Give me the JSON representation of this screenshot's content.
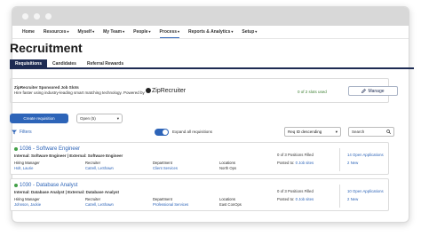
{
  "nav": {
    "items": [
      {
        "label": "Home",
        "caret": false
      },
      {
        "label": "Resources",
        "caret": true
      },
      {
        "label": "Myself",
        "caret": true
      },
      {
        "label": "My Team",
        "caret": true
      },
      {
        "label": "People",
        "caret": true
      },
      {
        "label": "Process",
        "caret": true
      },
      {
        "label": "Reports & Analytics",
        "caret": true
      },
      {
        "label": "Setup",
        "caret": true
      }
    ],
    "active": "Process"
  },
  "page_title": "Recruitment",
  "tabs": [
    "Requisitions",
    "Candidates",
    "Referral Rewards"
  ],
  "ziprecruiter": {
    "line1": "ZipRecruiter Sponsored Job Slots",
    "line2": "Hire faster using industry-leading smart matching technology. Powered by",
    "logo_text": "ZipRecruiter",
    "slots_used": "0 of 2 slots used",
    "manage_label": "Manage"
  },
  "toolbar": {
    "create_label": "Create requisition",
    "status_value": "Open (5)",
    "filters_label": "Filters",
    "expand_label": "Expand all requisitions",
    "sort_value": "Req ID descending",
    "search_placeholder": "Search"
  },
  "requisitions": [
    {
      "title": "1036 - Software Engineer",
      "subtitle": "Internal: Software Engineer | External: Software Engineer",
      "hiring_manager_label": "Hiring Manager",
      "hiring_manager": "Holt, Laurie",
      "recruiter_label": "Recruiter",
      "recruiter": "Catrell, LeShawn",
      "department_label": "Department",
      "department": "Client Services",
      "locations_label": "Locations",
      "locations": "North Ops",
      "positions_filled": "0 of 3 Positions Filled",
      "posted_to_label": "Posted to:",
      "posted_to_value": "0 Job sites",
      "open_applications": "14 Open Applications",
      "new_applications": "2 New"
    },
    {
      "title": "1030 - Database Analyst",
      "subtitle": "Internal: Database Analyst | External: Database Analyst",
      "hiring_manager_label": "Hiring Manager",
      "hiring_manager": "Johnson, Jackie",
      "recruiter_label": "Recruiter",
      "recruiter": "Catrell, LeShawn",
      "department_label": "Department",
      "department": "Professional Services",
      "locations_label": "Locations",
      "locations": "East ConOps",
      "positions_filled": "0 of 3 Positions Filled",
      "posted_to_label": "Posted to:",
      "posted_to_value": "0 Job sites",
      "open_applications": "10 Open Applications",
      "new_applications": "2 New"
    }
  ],
  "colors": {
    "accent": "#2d64b8",
    "navy": "#1d2b53",
    "status_open": "#43a047",
    "slots_green": "#3a7d2e"
  },
  "icons": [
    "filter-icon",
    "chevron-down-icon",
    "search-icon",
    "pencil-icon",
    "status-dot-icon"
  ]
}
